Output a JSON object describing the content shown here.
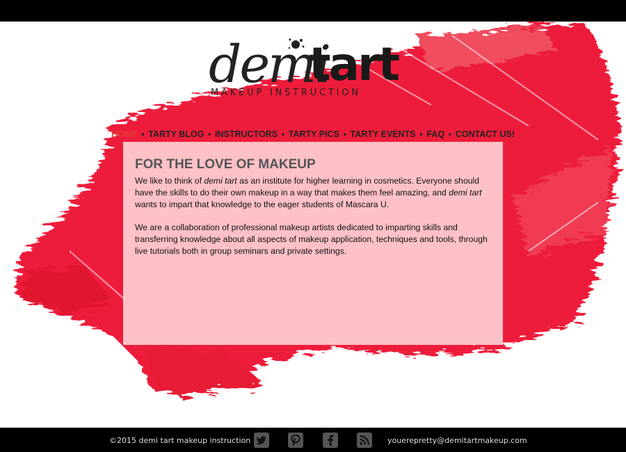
{
  "logo": {
    "word1": "demi",
    "word2": "tart",
    "tagline": "MAKEUP INSTRUCTION"
  },
  "nav": {
    "items": [
      {
        "label": "HOME",
        "active": true
      },
      {
        "label": "TARTY BLOG"
      },
      {
        "label": "INSTRUCTORS"
      },
      {
        "label": "TARTY PICS"
      },
      {
        "label": "TARTY EVENTS"
      },
      {
        "label": "FAQ"
      },
      {
        "label": "CONTACT US!"
      }
    ],
    "separator": "•"
  },
  "main": {
    "title": "FOR THE LOVE OF MAKEUP",
    "p1": {
      "a": "We like to think of ",
      "b": "demi tart",
      "c": " as an institute for higher learning in cosmetics.  Everyone should have the skills to do their own makeup in a way that makes them feel amazing, and ",
      "d": "demi tart",
      "e": " wants to impart that knowledge to the eager students of Mascara U."
    },
    "p2": "We are a collaboration of professional makeup artists dedicated to imparting skills and transferring knowledge about all aspects of makeup application, techniques and tools, through live tutorials both in group seminars and private settings."
  },
  "footer": {
    "copyright": "©2015 demi tart makeup instruction",
    "email": "youerepretty@demitartmakeup.com",
    "social": [
      {
        "icon": "twitter-icon"
      },
      {
        "icon": "pinterest-icon"
      },
      {
        "icon": "facebook-icon"
      },
      {
        "icon": "rss-icon"
      }
    ]
  },
  "colors": {
    "accent": "#e33b3b",
    "splash": "#ee1c3a",
    "panel": "#ffdcde",
    "bar": "#000000"
  }
}
